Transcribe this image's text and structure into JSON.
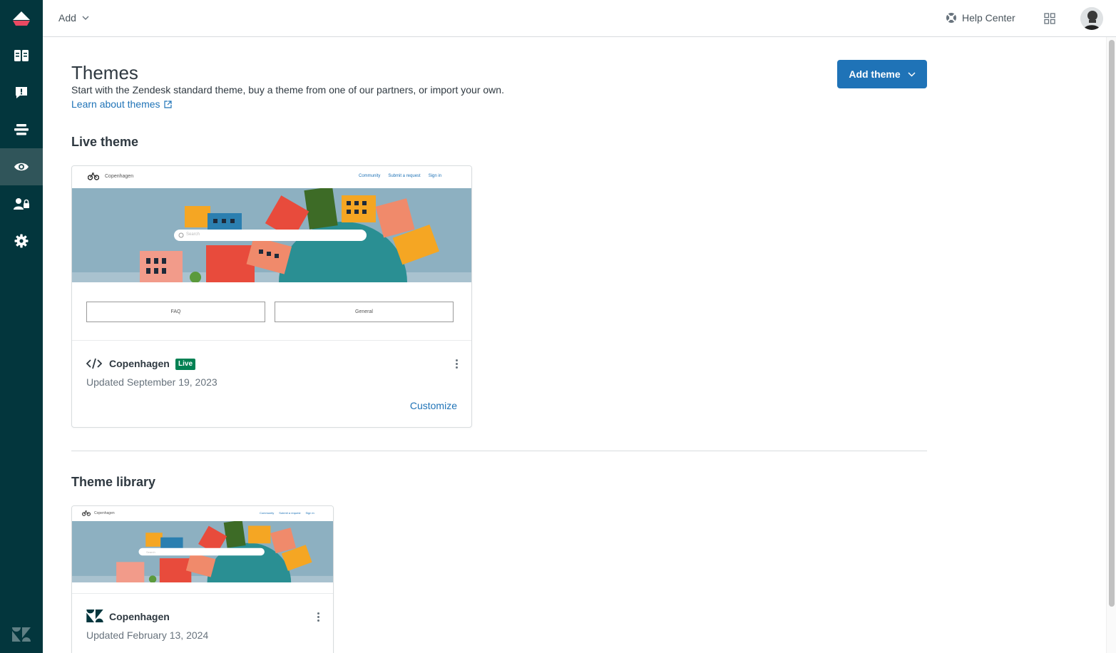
{
  "header": {
    "add_label": "Add",
    "help_center_label": "Help Center"
  },
  "sidebar": {
    "items": [
      {
        "name": "guide-articles",
        "icon": "book-icon"
      },
      {
        "name": "moderation",
        "icon": "feedback-icon"
      },
      {
        "name": "arrange-content",
        "icon": "list-icon"
      },
      {
        "name": "customize-design",
        "icon": "eye-icon",
        "active": true
      },
      {
        "name": "user-permissions",
        "icon": "user-lock-icon"
      },
      {
        "name": "settings",
        "icon": "gear-icon"
      }
    ]
  },
  "page": {
    "title": "Themes",
    "description": "Start with the Zendesk standard theme, buy a theme from one of our partners, or import your own.",
    "learn_link": "Learn about themes",
    "add_theme_button": "Add theme"
  },
  "live_section": {
    "title": "Live theme",
    "card": {
      "name": "Copenhagen",
      "badge": "Live",
      "updated": "Updated September 19, 2023",
      "action": "Customize",
      "preview": {
        "brand": "Copenhagen",
        "nav": [
          "Community",
          "Submit a request",
          "Sign in"
        ],
        "search_placeholder": "Search",
        "categories": [
          "FAQ",
          "General"
        ]
      }
    }
  },
  "library_section": {
    "title": "Theme library",
    "card": {
      "name": "Copenhagen",
      "updated": "Updated February 13, 2024",
      "preview": {
        "brand": "Copenhagen",
        "nav": [
          "Community",
          "Submit a request",
          "Sign in"
        ],
        "search_placeholder": "Search"
      }
    }
  },
  "colors": {
    "sidebar": "#03363d",
    "sidebar_active": "#30555a",
    "primary": "#1f73b7",
    "live_badge": "#038153",
    "logo_red": "#eb4962"
  }
}
